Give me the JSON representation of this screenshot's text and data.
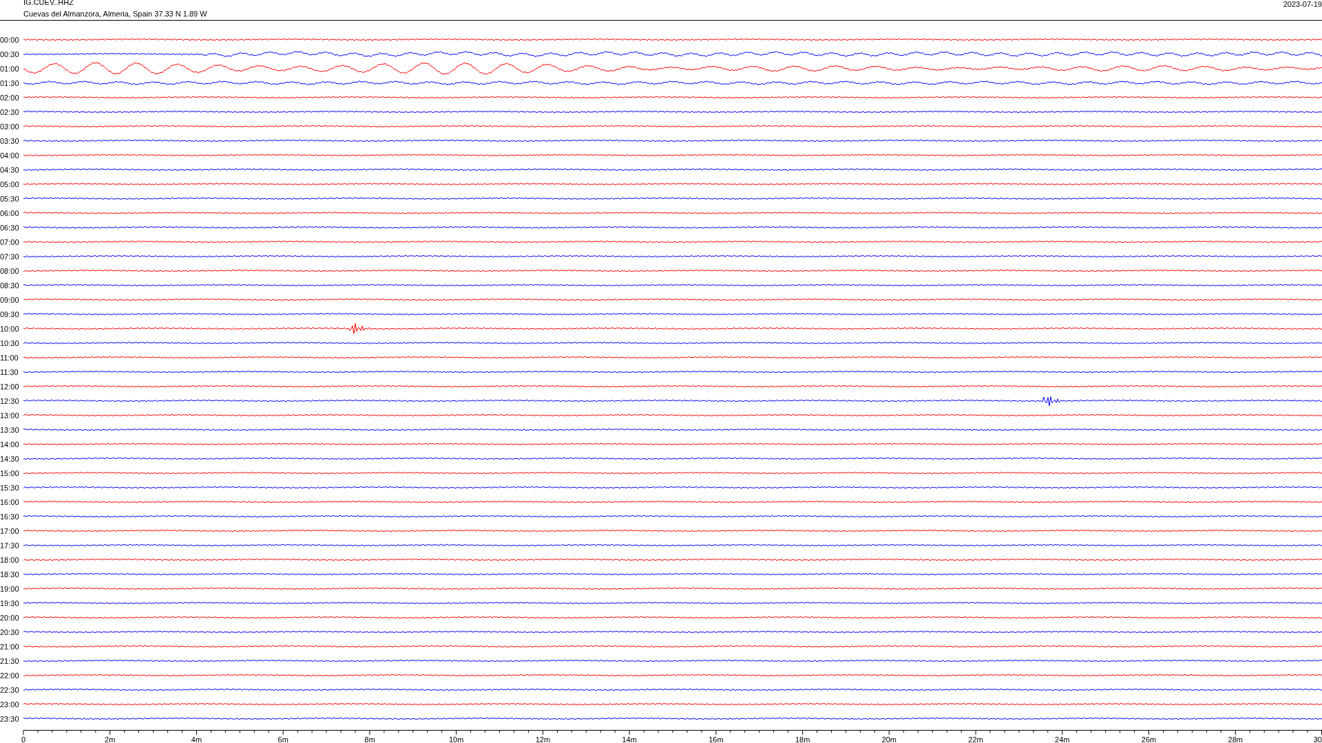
{
  "header": {
    "channel": "IG.CUEV..HHZ",
    "station": "Cuevas del Almanzora, Almeria, Spain  37.33 N 1.89 W",
    "date": "2023-07-19"
  },
  "rows": [
    {
      "time": "00:00",
      "color": "#ff0000",
      "kind": "noise"
    },
    {
      "time": "00:30",
      "color": "#0000ff",
      "kind": "swell"
    },
    {
      "time": "01:00",
      "color": "#ff0000",
      "kind": "large-swell"
    },
    {
      "time": "01:30",
      "color": "#0000ff",
      "kind": "small-swell"
    },
    {
      "time": "02:00",
      "color": "#ff0000",
      "kind": "noise"
    },
    {
      "time": "02:30",
      "color": "#0000ff",
      "kind": "noise"
    },
    {
      "time": "03:00",
      "color": "#ff0000",
      "kind": "noise"
    },
    {
      "time": "03:30",
      "color": "#0000ff",
      "kind": "noise"
    },
    {
      "time": "04:00",
      "color": "#ff0000",
      "kind": "noise"
    },
    {
      "time": "04:30",
      "color": "#0000ff",
      "kind": "noise"
    },
    {
      "time": "05:00",
      "color": "#ff0000",
      "kind": "noise"
    },
    {
      "time": "05:30",
      "color": "#0000ff",
      "kind": "noise"
    },
    {
      "time": "06:00",
      "color": "#ff0000",
      "kind": "noise"
    },
    {
      "time": "06:30",
      "color": "#0000ff",
      "kind": "noise"
    },
    {
      "time": "07:00",
      "color": "#ff0000",
      "kind": "noise"
    },
    {
      "time": "07:30",
      "color": "#0000ff",
      "kind": "noise"
    },
    {
      "time": "08:00",
      "color": "#ff0000",
      "kind": "noise"
    },
    {
      "time": "08:30",
      "color": "#0000ff",
      "kind": "noise"
    },
    {
      "time": "09:00",
      "color": "#ff0000",
      "kind": "noise"
    },
    {
      "time": "09:30",
      "color": "#0000ff",
      "kind": "noise"
    },
    {
      "time": "10:00",
      "color": "#ff0000",
      "kind": "event"
    },
    {
      "time": "10:30",
      "color": "#0000ff",
      "kind": "noise"
    },
    {
      "time": "11:00",
      "color": "#ff0000",
      "kind": "noise"
    },
    {
      "time": "11:30",
      "color": "#0000ff",
      "kind": "noise"
    },
    {
      "time": "12:00",
      "color": "#ff0000",
      "kind": "noise"
    },
    {
      "time": "12:30",
      "color": "#0000ff",
      "kind": "event"
    },
    {
      "time": "13:00",
      "color": "#ff0000",
      "kind": "noise"
    },
    {
      "time": "13:30",
      "color": "#0000ff",
      "kind": "noise"
    },
    {
      "time": "14:00",
      "color": "#ff0000",
      "kind": "noise"
    },
    {
      "time": "14:30",
      "color": "#0000ff",
      "kind": "noise"
    },
    {
      "time": "15:00",
      "color": "#ff0000",
      "kind": "noise"
    },
    {
      "time": "15:30",
      "color": "#0000ff",
      "kind": "noise"
    },
    {
      "time": "16:00",
      "color": "#ff0000",
      "kind": "noise"
    },
    {
      "time": "16:30",
      "color": "#0000ff",
      "kind": "noise"
    },
    {
      "time": "17:00",
      "color": "#ff0000",
      "kind": "noise"
    },
    {
      "time": "17:30",
      "color": "#0000ff",
      "kind": "noise"
    },
    {
      "time": "18:00",
      "color": "#ff0000",
      "kind": "noise"
    },
    {
      "time": "18:30",
      "color": "#0000ff",
      "kind": "noise"
    },
    {
      "time": "19:00",
      "color": "#ff0000",
      "kind": "noise"
    },
    {
      "time": "19:30",
      "color": "#0000ff",
      "kind": "noise"
    },
    {
      "time": "20:00",
      "color": "#ff0000",
      "kind": "noise"
    },
    {
      "time": "20:30",
      "color": "#0000ff",
      "kind": "noise"
    },
    {
      "time": "21:00",
      "color": "#ff0000",
      "kind": "noise"
    },
    {
      "time": "21:30",
      "color": "#0000ff",
      "kind": "noise"
    },
    {
      "time": "22:00",
      "color": "#ff0000",
      "kind": "noise"
    },
    {
      "time": "22:30",
      "color": "#0000ff",
      "kind": "noise"
    },
    {
      "time": "23:00",
      "color": "#ff0000",
      "kind": "noise"
    },
    {
      "time": "23:30",
      "color": "#0000ff",
      "kind": "noise"
    }
  ],
  "axis": {
    "labels": [
      "0",
      "2m",
      "4m",
      "6m",
      "8m",
      "10m",
      "12m",
      "14m",
      "16m",
      "18m",
      "20m",
      "22m",
      "24m",
      "26m",
      "28m",
      "30"
    ]
  }
}
